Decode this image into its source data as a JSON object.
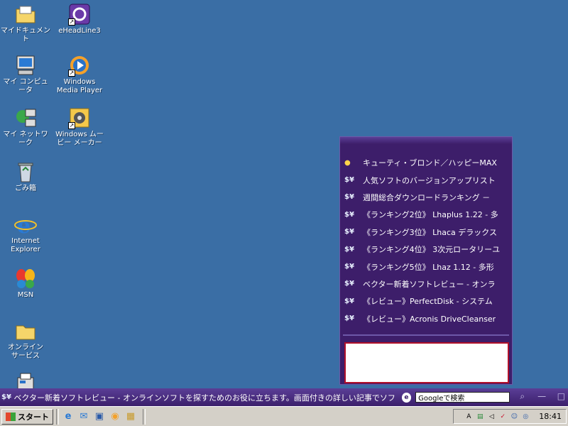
{
  "desktop": {
    "icons": [
      {
        "label": "マイドキュメント",
        "icon": "my-documents-folder-icon"
      },
      {
        "label": "eHeadLine3",
        "icon": "eheadline-icon"
      },
      {
        "label": "マイ コンピュータ",
        "icon": "my-computer-icon"
      },
      {
        "label": "Windows\nMedia Player",
        "icon": "media-player-icon"
      },
      {
        "label": "マイ ネットワーク",
        "icon": "network-icon"
      },
      {
        "label": "Windows ムー\nビー メーカー",
        "icon": "movie-maker-icon"
      },
      {
        "label": "ごみ箱",
        "icon": "recycle-bin-icon"
      },
      {
        "label": "Internet\nExplorer",
        "icon": "internet-explorer-icon"
      },
      {
        "label": "MSN",
        "icon": "msn-butterfly-icon"
      },
      {
        "label": "オンライン\nサービス",
        "icon": "online-services-folder-icon"
      }
    ]
  },
  "panel": {
    "items": [
      {
        "badge": "●",
        "text": "キューティ・ブロンド／ハッピーMAX"
      },
      {
        "badge": "$¥",
        "text": "人気ソフトのバージョンアップリスト"
      },
      {
        "badge": "$¥",
        "text": "週間総合ダウンロードランキング －"
      },
      {
        "badge": "$¥",
        "text": "《ランキング2位》 Lhaplus 1.22 - 多"
      },
      {
        "badge": "$¥",
        "text": "《ランキング3位》 Lhaca デラックス"
      },
      {
        "badge": "$¥",
        "text": "《ランキング4位》 3次元ロータリーユ"
      },
      {
        "badge": "$¥",
        "text": "《ランキング5位》 Lhaz 1.12 - 多形"
      },
      {
        "badge": "$¥",
        "text": "ベクター新着ソフトレビュー - オンラ"
      },
      {
        "badge": "$¥",
        "text": "《レビュー》PerfectDisk - システム"
      },
      {
        "badge": "$¥",
        "text": "《レビュー》Acronis DriveCleanser"
      }
    ]
  },
  "ticker": {
    "icon": "$¥",
    "text": "ベクター新着ソフトレビュー - オンラインソフトを探すためのお役に立ちます。画面付きの詳しい記事でソフト",
    "g_icon": "e",
    "search_value": "Googleで検索"
  },
  "taskbar": {
    "start_label": "スタート",
    "clock": "18:41"
  }
}
